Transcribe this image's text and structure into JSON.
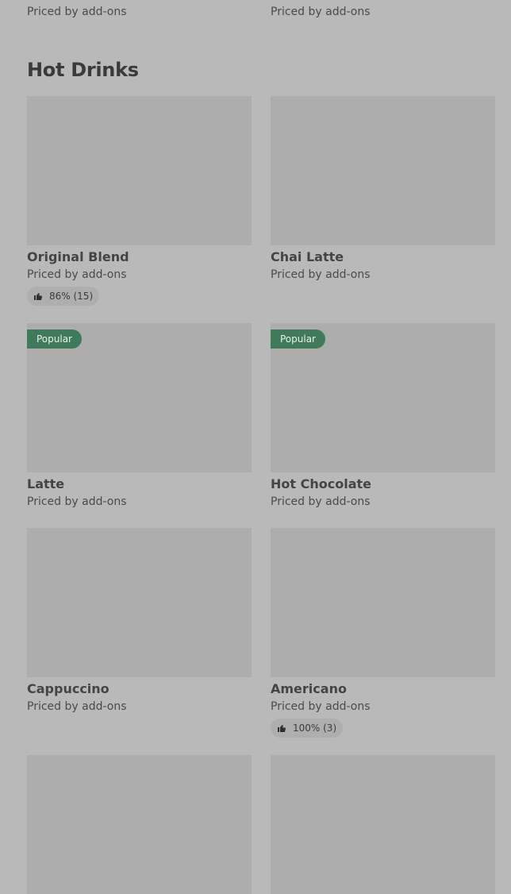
{
  "top_partial": {
    "left_sub": "Priced by add-ons",
    "right_sub": "Priced by add-ons"
  },
  "section": {
    "title": "Hot Drinks"
  },
  "items": [
    {
      "name": "Original Blend",
      "sub": "Priced by add-ons",
      "rating": "86% (15)"
    },
    {
      "name": "Chai Latte",
      "sub": "Priced by add-ons"
    },
    {
      "name": "Latte",
      "sub": "Priced by add-ons",
      "badge": "Popular"
    },
    {
      "name": "Hot Chocolate",
      "sub": "Priced by add-ons",
      "badge": "Popular"
    },
    {
      "name": "Cappuccino",
      "sub": "Priced by add-ons"
    },
    {
      "name": "Americano",
      "sub": "Priced by add-ons",
      "rating": "100% (3)"
    }
  ]
}
